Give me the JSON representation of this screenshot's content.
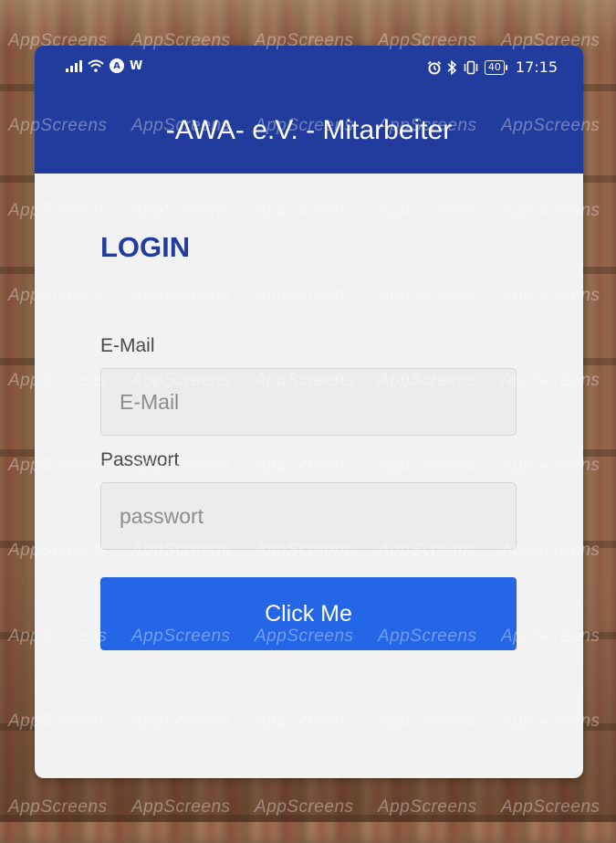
{
  "status_bar": {
    "left_icons": [
      "signal-icon",
      "wifi-icon",
      "app-notification-icon",
      "w-notification-icon"
    ],
    "w_label": "W",
    "a_label": "A",
    "right_icons": [
      "alarm-icon",
      "bluetooth-icon",
      "vibrate-icon",
      "battery-icon"
    ],
    "battery_level": "40",
    "time": "17:15"
  },
  "header": {
    "title": "-AWA- e.V. - Mitarbeiter",
    "background_color": "#213c9c"
  },
  "login": {
    "heading": "LOGIN",
    "email_label": "E-Mail",
    "email_placeholder": "E-Mail",
    "email_value": "",
    "password_label": "Passwort",
    "password_placeholder": "passwort",
    "password_value": "",
    "submit_label": "Click Me",
    "submit_color": "#2566e6"
  },
  "watermark": {
    "text": "AppScreens"
  }
}
